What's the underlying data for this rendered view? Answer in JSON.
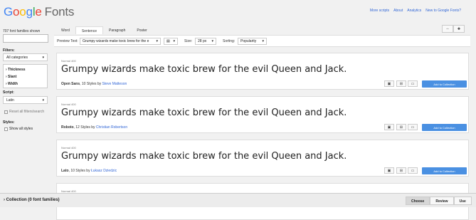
{
  "header": {
    "logo_google": [
      "G",
      "o",
      "o",
      "g",
      "l",
      "e"
    ],
    "logo_fonts": "Fonts",
    "links": [
      "More scripts",
      "About",
      "Analytics",
      "New to Google Fonts?"
    ]
  },
  "sidebar": {
    "count": "707 font families shown",
    "filters_label": "Filters:",
    "category_value": "All categories",
    "filter_items": [
      "› Thickness",
      "› Slant",
      "› Width"
    ],
    "script_label": "Script:",
    "script_value": "Latin",
    "reset_label": "Reset all filters/search",
    "styles_label": "Styles:",
    "show_all_label": "Show all styles"
  },
  "tabs": [
    "Word",
    "Sentence",
    "Paragraph",
    "Poster"
  ],
  "active_tab": "Sentence",
  "toolbar": {
    "preview_label": "Preview Text:",
    "preview_value": "Grumpy wizards make toxic brew for the e",
    "size_label": "Size:",
    "size_value": "28 px",
    "sorting_label": "Sorting:",
    "sorting_value": "Popularity"
  },
  "cards": [
    {
      "style": "Normal 400",
      "sample": "Grumpy wizards make toxic brew for the evil Queen and Jack.",
      "name": "Open Sans",
      "styles": ", 10 Styles by ",
      "author": "Steve Matteson",
      "add": "Add to Collection"
    },
    {
      "style": "Normal 400",
      "sample": "Grumpy wizards make toxic brew for the evil Queen and Jack.",
      "name": "Roboto",
      "styles": ", 12 Styles by ",
      "author": "Christian Robertson",
      "add": "Add to Collection"
    },
    {
      "style": "Normal 400",
      "sample": "Grumpy wizards make toxic brew for the evil Queen and Jack.",
      "name": "Lato",
      "styles": ", 10 Styles by ",
      "author": "Łukasz Dziedzic",
      "add": "Add to Collection"
    },
    {
      "style": "Normal 400"
    }
  ],
  "footer": {
    "collection": "› Collection (0 font families)",
    "buttons": [
      "Choose",
      "Review",
      "Use"
    ]
  },
  "colors": {
    "accent": "#4a90e2",
    "link": "#3367d6"
  }
}
